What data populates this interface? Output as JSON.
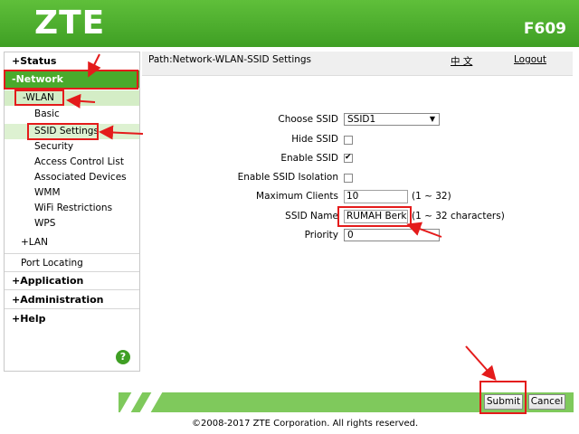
{
  "header": {
    "brand": "ZTE",
    "model": "F609"
  },
  "nav": {
    "status": "+Status",
    "network": "-Network",
    "wlan": "-WLAN",
    "wlan_items": [
      "Basic",
      "SSID Settings",
      "Security",
      "Access Control List",
      "Associated Devices",
      "WMM",
      "WiFi Restrictions",
      "WPS"
    ],
    "lan": "+LAN",
    "port_locating": "Port Locating",
    "application": "+Application",
    "administration": "+Administration",
    "help": "+Help",
    "help_icon": "?"
  },
  "pathbar": {
    "path": "Path:Network-WLAN-SSID Settings",
    "language": "中 文",
    "logout": "Logout"
  },
  "form": {
    "choose_ssid_label": "Choose SSID",
    "choose_ssid_value": "SSID1",
    "hide_ssid_label": "Hide SSID",
    "hide_ssid_checked": false,
    "enable_ssid_label": "Enable SSID",
    "enable_ssid_checked": true,
    "isolation_label": "Enable SSID Isolation",
    "isolation_checked": false,
    "max_clients_label": "Maximum Clients",
    "max_clients_value": "10",
    "max_clients_hint": "(1 ~ 32)",
    "ssid_name_label": "SSID Name",
    "ssid_name_value": "RUMAH Berka",
    "ssid_name_hint": "(1 ~ 32 characters)",
    "priority_label": "Priority",
    "priority_value": "0"
  },
  "buttons": {
    "submit": "Submit",
    "cancel": "Cancel"
  },
  "footer": {
    "copyright": "©2008-2017 ZTE Corporation. All rights reserved."
  },
  "colors": {
    "brand_green": "#4aaa2c",
    "annotation_red": "#e41b1b"
  }
}
